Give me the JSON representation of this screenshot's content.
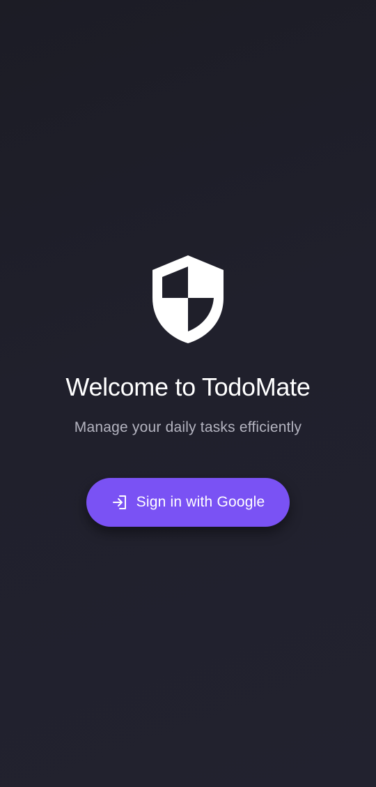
{
  "app": {
    "logo_icon": "shield-icon",
    "title": "Welcome to TodoMate",
    "subtitle": "Manage your daily tasks efficiently"
  },
  "signin": {
    "icon": "login-arrow-icon",
    "label": "Sign in with Google"
  },
  "colors": {
    "background": "#20202c",
    "accent": "#7a52f4",
    "title_text": "#ffffff",
    "subtitle_text": "#b4b4c0"
  }
}
